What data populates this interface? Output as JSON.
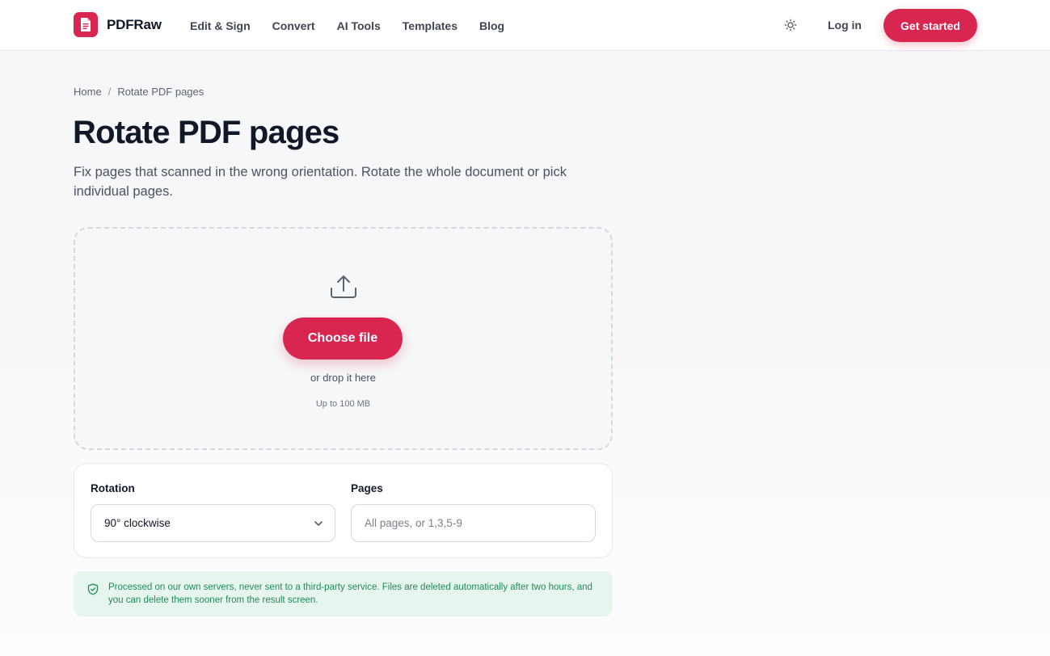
{
  "header": {
    "brand": "PDFRaw",
    "nav": [
      "Edit & Sign",
      "Convert",
      "AI Tools",
      "Templates",
      "Blog"
    ],
    "login": "Log in",
    "cta": "Get started"
  },
  "breadcrumb": {
    "home": "Home",
    "separator": "/",
    "current": "Rotate PDF pages"
  },
  "page": {
    "title": "Rotate PDF pages",
    "subtitle": "Fix pages that scanned in the wrong orientation. Rotate the whole document or pick individual pages."
  },
  "upload": {
    "button": "Choose file",
    "drop_hint": "or drop it here",
    "limit": "Up to 100 MB"
  },
  "options": {
    "rotation_label": "Rotation",
    "rotation_value": "90° clockwise",
    "pages_label": "Pages",
    "pages_placeholder": "All pages, or 1,3,5-9"
  },
  "notice": {
    "text": "Processed on our own servers, never sent to a third-party service. Files are deleted automatically after two hours, and you can delete them sooner from the result screen."
  },
  "colors": {
    "accent": "#d92650",
    "notice_bg": "#e6f6ee",
    "notice_text": "#1f8a5a"
  },
  "icons": [
    "pdf-logo-icon",
    "sun-icon",
    "upload-icon",
    "chevron-down-icon",
    "shield-check-icon"
  ]
}
